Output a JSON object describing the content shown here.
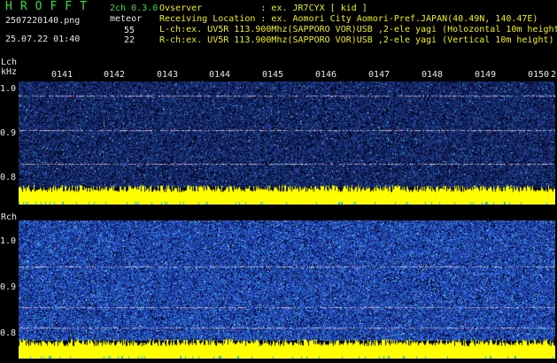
{
  "header": {
    "app_title": "HROFFT",
    "filename": "2507220140.png",
    "datetime": "25.07.22 01:40",
    "mode": "2ch 0.3.0",
    "mode_label": "meteor",
    "count_lch": "55",
    "count_rch": "22",
    "observer": "Ovserver           : ex. JR7CYX [ kid ]",
    "location": "Receiving Location : ex. Aomori City Aomori-Pref.JAPAN(40.49N, 140.47E)",
    "lch_info": "L-ch:ex. UV5R 113.900Mhz(SAPPORO VOR)USB ,2-ele yagi (Holozontal 10m height",
    "rch_info": "R-ch:ex. UV5R 113.900Mhz(SAPPORO VOR)USB ,2-ele yagi (Vertical 10m height)"
  },
  "time_ticks": [
    "0141",
    "0142",
    "0143",
    "0144",
    "0145",
    "0146",
    "0147",
    "0148",
    "0149",
    "0150",
    "2"
  ],
  "lch": {
    "label": "Lch",
    "unit": "kHz",
    "y_labels": [
      "1.0",
      "0.9",
      "0.8"
    ]
  },
  "rch": {
    "label": "Rch",
    "y_labels": [
      "1.0",
      "0.9",
      "0.8"
    ]
  },
  "colors": {
    "background": "#000000",
    "noise_base": "#0a1e9e",
    "trace": "#ffff00",
    "text_green": "#2ee02e",
    "text_yellow": "#f0f000"
  }
}
